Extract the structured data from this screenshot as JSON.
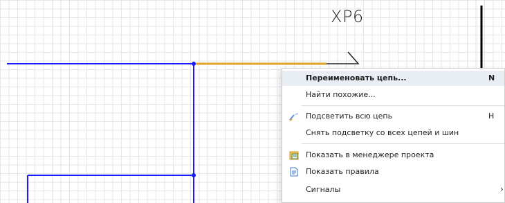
{
  "schematic": {
    "ref_label": "XP6",
    "colors": {
      "wire": "#1a1aff",
      "highlight_wire": "#e0a326",
      "bus": "#000000"
    }
  },
  "context_menu": {
    "items": [
      {
        "label": "Переименовать цепь...",
        "shortcut": "N",
        "icon": "",
        "highlighted": true
      },
      {
        "label": "Найти похожие...",
        "shortcut": "",
        "icon": ""
      },
      {
        "label": "Подсветить всю цепь",
        "shortcut": "H",
        "icon": "highlight-net-icon"
      },
      {
        "label": "Снять подсветку со всех цепей и шин",
        "shortcut": "",
        "icon": ""
      },
      {
        "label": "Показать в менеджере проекта",
        "shortcut": "",
        "icon": "project-manager-icon"
      },
      {
        "label": "Показать правила",
        "shortcut": "",
        "icon": "rules-icon"
      },
      {
        "label": "Сигналы",
        "shortcut": "",
        "icon": "",
        "submenu_glyph": "›"
      }
    ]
  }
}
